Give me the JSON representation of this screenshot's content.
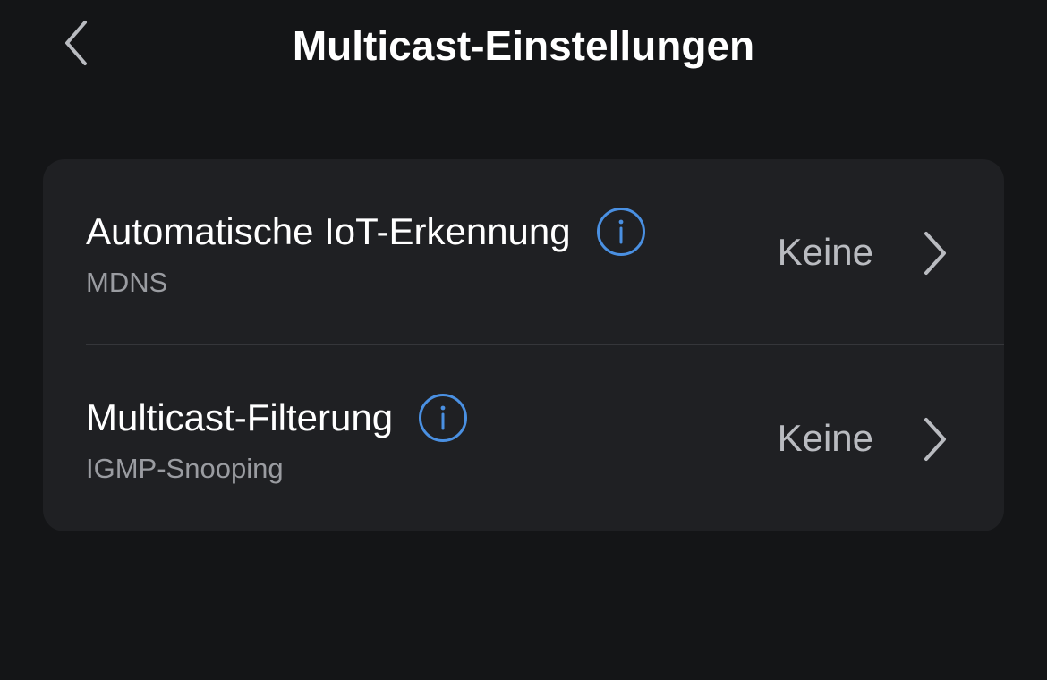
{
  "header": {
    "title": "Multicast-Einstellungen",
    "back_icon": "chevron-left-icon"
  },
  "settings": {
    "items": [
      {
        "title": "Automatische IoT-Erkennung",
        "subtitle": "MDNS",
        "value": "Keine",
        "info_icon": "info-icon",
        "chevron_icon": "chevron-right-icon"
      },
      {
        "title": "Multicast-Filterung",
        "subtitle": "IGMP-Snooping",
        "value": "Keine",
        "info_icon": "info-icon",
        "chevron_icon": "chevron-right-icon"
      }
    ]
  },
  "colors": {
    "background": "#141517",
    "card": "#1f2023",
    "accent": "#4a90e2",
    "secondary_text": "#9a9ca1"
  }
}
